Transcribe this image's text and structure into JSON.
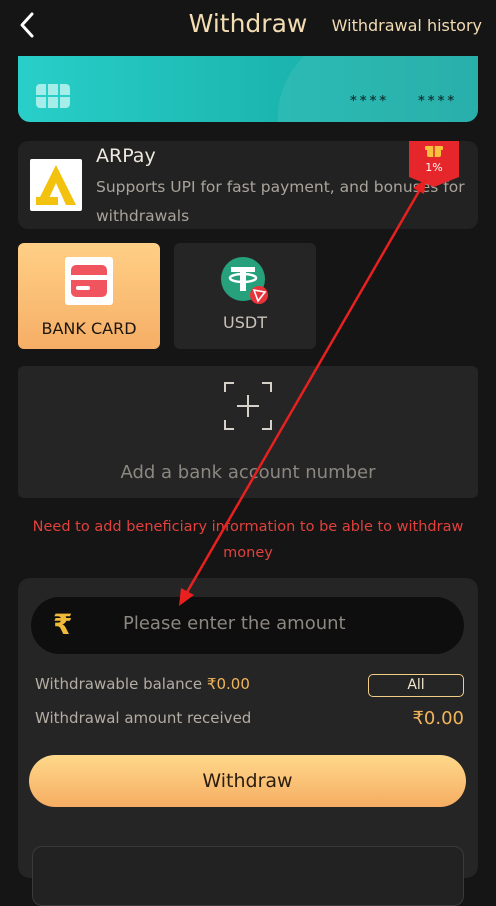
{
  "header": {
    "title": "Withdraw",
    "history_link": "Withdrawal history"
  },
  "card": {
    "number_left": "****",
    "number_right": "****"
  },
  "pay_option": {
    "name": "ARPay",
    "description": "Supports UPI for fast payment, and bonuses for withdrawals",
    "badge": "1%"
  },
  "methods": [
    {
      "label": "BANK CARD",
      "icon": "bank-card-icon",
      "selected": true
    },
    {
      "label": "USDT",
      "icon": "usdt-icon",
      "selected": false
    }
  ],
  "add_account": {
    "label": "Add a bank account number"
  },
  "warning": "Need to add beneficiary information to be able to withdraw money",
  "form": {
    "currency_symbol": "₹",
    "amount_placeholder": "Please enter the amount",
    "balance_label": "Withdrawable balance",
    "balance_value": "₹0.00",
    "all_button": "All",
    "received_label": "Withdrawal amount received",
    "received_value": "₹0.00",
    "withdraw_button": "Withdraw"
  },
  "colors": {
    "accent_gold": "#f5ad63",
    "teal_card": "#28cfc8",
    "warning": "#e0413c",
    "annotation_arrow": "#e8201f"
  }
}
